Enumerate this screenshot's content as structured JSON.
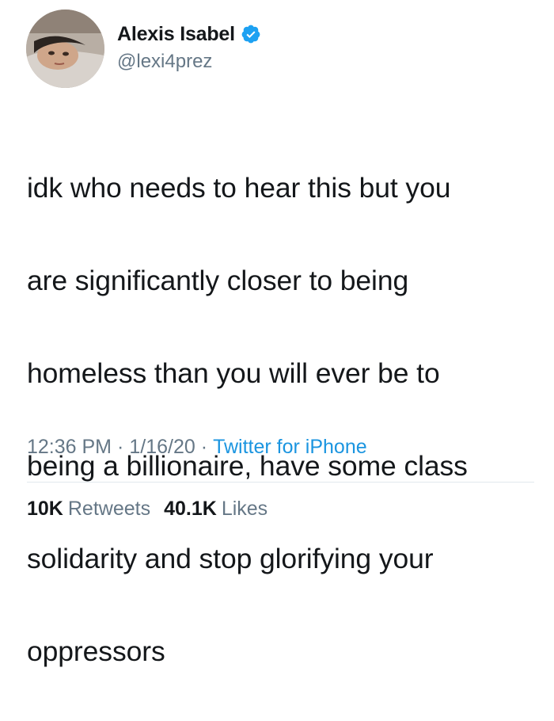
{
  "user": {
    "display_name": "Alexis Isabel",
    "handle": "@lexi4prez",
    "verified": true,
    "avatar": "profile-photo"
  },
  "tweet": {
    "lines": [
      "idk who needs to hear this but you",
      "are significantly closer to being",
      "homeless than you will ever be to",
      "being a billionaire, have some class",
      "solidarity and stop glorifying your",
      "oppressors"
    ]
  },
  "meta": {
    "time": "12:36 PM",
    "separator": "·",
    "date": "1/16/20",
    "source": "Twitter for iPhone"
  },
  "stats": {
    "retweets_count": "10K",
    "retweets_label": "Retweets",
    "likes_count": "40.1K",
    "likes_label": "Likes"
  },
  "colors": {
    "text": "#14171a",
    "secondary": "#657786",
    "link": "#1b95e0",
    "verified_badge": "#1da1f2",
    "divider": "#e1e8ed"
  }
}
